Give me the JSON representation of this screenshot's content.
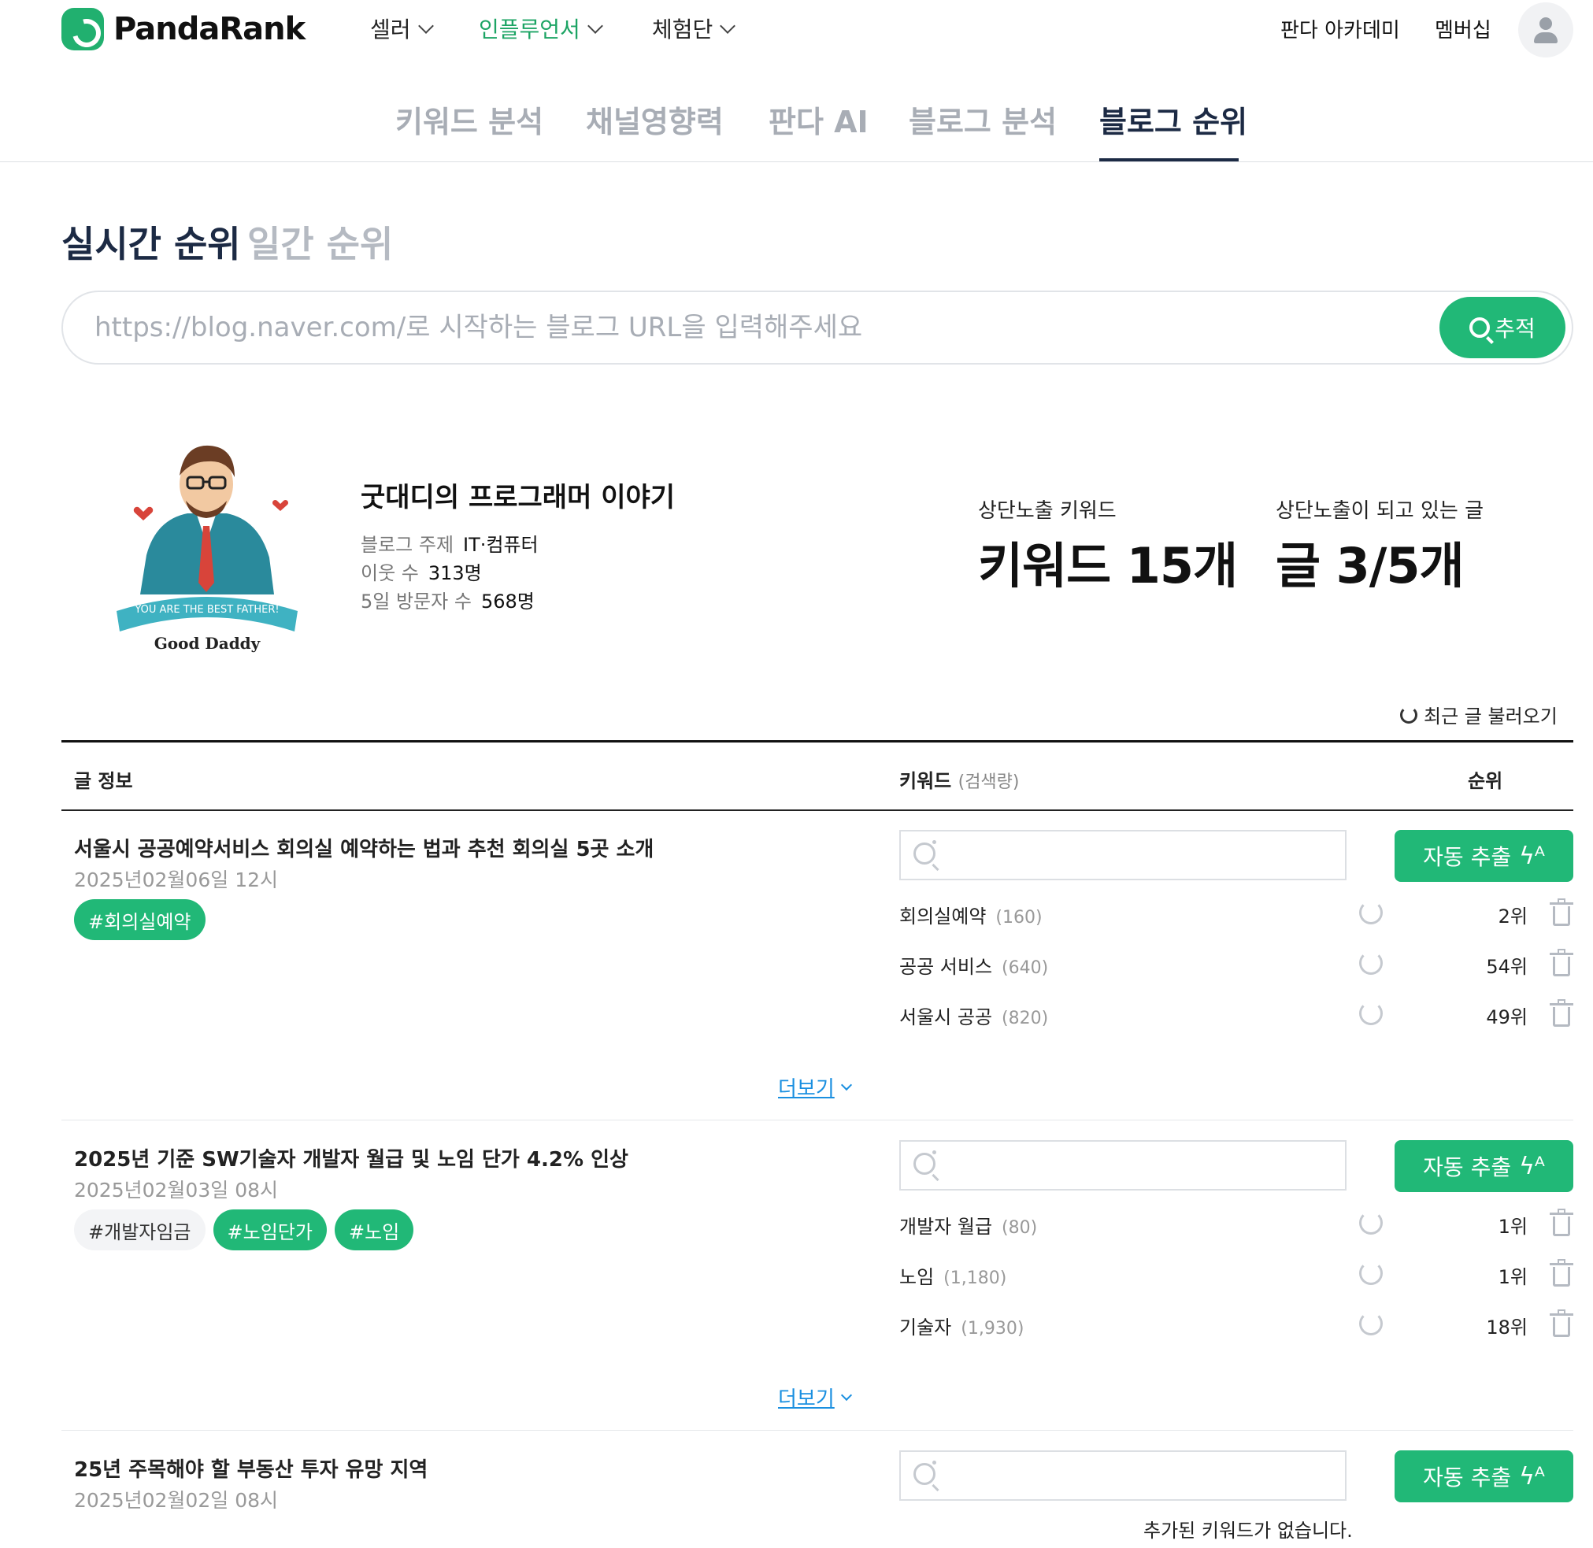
{
  "header": {
    "logo": "PandaRank",
    "nav": [
      {
        "label": "셀러"
      },
      {
        "label": "인플루언서"
      },
      {
        "label": "체험단"
      }
    ],
    "academy": "판다 아카데미",
    "membership": "멤버십"
  },
  "tabs": [
    "키워드 분석",
    "채널영향력",
    "판다 AI",
    "블로그 분석",
    "블로그 순위"
  ],
  "active_tab": "블로그 순위",
  "sections": {
    "realtime": "실시간 순위",
    "daily": "일간 순위"
  },
  "search": {
    "placeholder": "https://blog.naver.com/로 시작하는 블로그 URL을 입력해주세요",
    "button": "추적"
  },
  "profile": {
    "image_text_banner": "YOU ARE THE BEST FATHER!",
    "image_text_name": "Good Daddy",
    "blog_name": "굿대디의 프로그래머 이야기",
    "topic_label": "블로그 주제",
    "topic_value": "IT·컴퓨터",
    "neighbors_label": "이웃 수",
    "neighbors_value": "313명",
    "visitors_label": "5일 방문자 수",
    "visitors_value": "568명"
  },
  "stats": {
    "keywords_label": "상단노출 키워드",
    "keywords_value": "키워드 15개",
    "posts_label": "상단노출이 되고 있는 글",
    "posts_value": "글 3/5개"
  },
  "recent_button": "최근 글 불러오기",
  "table": {
    "col_post": "글 정보",
    "col_keyword": "키워드",
    "col_keyword_sub": "(검색량)",
    "col_rank": "순위",
    "auto_extract": "자동 추출",
    "more": "더보기",
    "empty": "추가된 키워드가 없습니다."
  },
  "posts": [
    {
      "title": "서울시 공공예약서비스 회의실 예약하는 법과 추천 회의실 5곳 소개",
      "date": "2025년02월06일 12시",
      "tags": [
        {
          "label": "#회의실예약",
          "active": true
        }
      ],
      "keywords": [
        {
          "name": "회의실예약",
          "volume": "(160)",
          "rank": "2위"
        },
        {
          "name": "공공 서비스",
          "volume": "(640)",
          "rank": "54위"
        },
        {
          "name": "서울시 공공",
          "volume": "(820)",
          "rank": "49위"
        }
      ]
    },
    {
      "title": "2025년 기준 SW기술자 개발자 월급 및 노임 단가 4.2% 인상",
      "date": "2025년02월03일 08시",
      "tags": [
        {
          "label": "#개발자임금",
          "active": false
        },
        {
          "label": "#노임단가",
          "active": true
        },
        {
          "label": "#노임",
          "active": true
        }
      ],
      "keywords": [
        {
          "name": "개발자 월급",
          "volume": "(80)",
          "rank": "1위"
        },
        {
          "name": "노임",
          "volume": "(1,180)",
          "rank": "1위"
        },
        {
          "name": "기술자",
          "volume": "(1,930)",
          "rank": "18위"
        }
      ]
    },
    {
      "title": "25년 주목해야 할 부동산 투자 유망 지역",
      "date": "2025년02월02일 08시",
      "tags": [],
      "keywords": []
    }
  ],
  "colors": {
    "accent": "#21b877",
    "navy": "#1c2a44",
    "link": "#1a8fe0"
  }
}
